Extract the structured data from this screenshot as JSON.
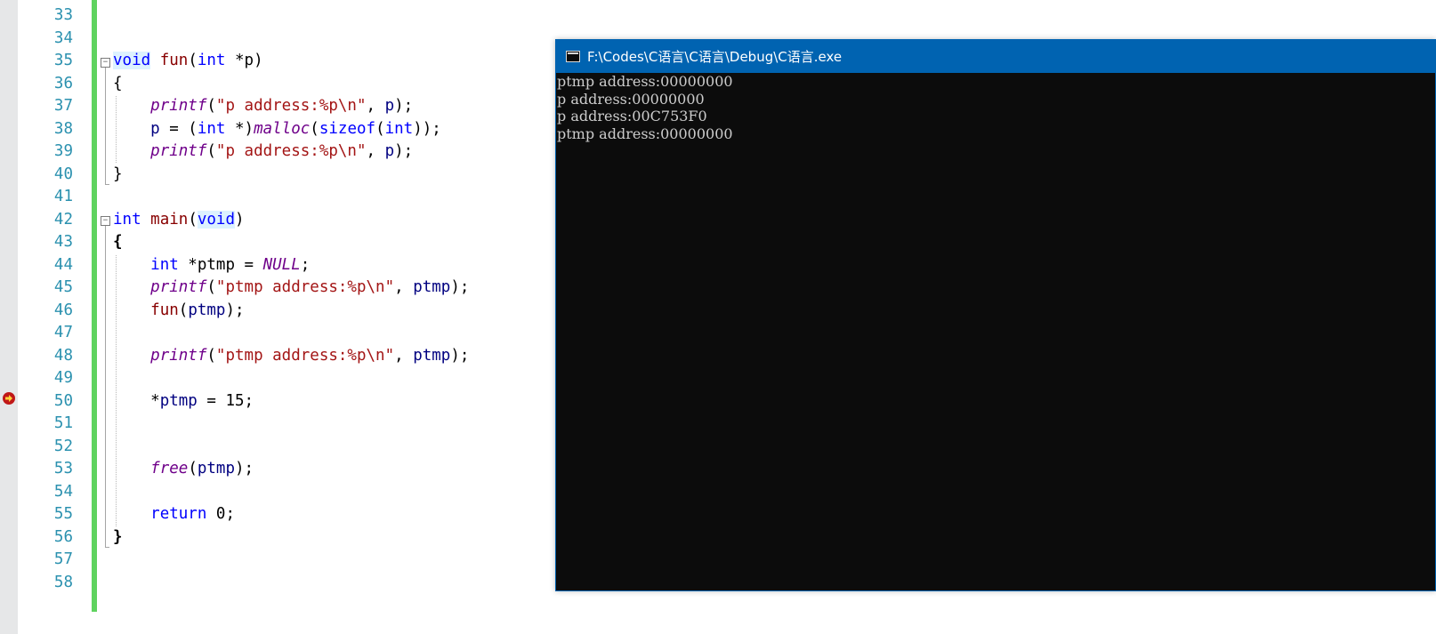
{
  "editor": {
    "line_numbers": [
      "33",
      "34",
      "35",
      "36",
      "37",
      "38",
      "39",
      "40",
      "41",
      "42",
      "43",
      "44",
      "45",
      "46",
      "47",
      "48",
      "49",
      "50",
      "51",
      "52",
      "53",
      "54",
      "55",
      "56",
      "57",
      "58"
    ],
    "breakpoint_line": "50",
    "code": {
      "l35": {
        "kw": "void",
        "fn": "fun",
        "p1": "(",
        "kw2": "int",
        "rest": " *p)"
      },
      "l36": "{",
      "l37": {
        "indent": "    ",
        "macro": "printf",
        "p1": "(",
        "str": "\"p address:%p\\n\"",
        "p2": ", ",
        "var": "p",
        "p3": ");"
      },
      "l38": {
        "indent": "    ",
        "var": "p",
        "p1": " = (",
        "kw": "int",
        "p2": " *)",
        "macro": "malloc",
        "p3": "(",
        "kw2": "sizeof",
        "p4": "(",
        "kw3": "int",
        "p5": "));"
      },
      "l39": {
        "indent": "    ",
        "macro": "printf",
        "p1": "(",
        "str": "\"p address:%p\\n\"",
        "p2": ", ",
        "var": "p",
        "p3": ");"
      },
      "l40": "}",
      "l42": {
        "kw": "int",
        "fn": "main",
        "p1": "(",
        "kw2": "void",
        "p2": ")"
      },
      "l43": "{",
      "l44": {
        "indent": "    ",
        "kw": "int",
        "p1": " *ptmp = ",
        "macro": "NULL",
        "p2": ";"
      },
      "l45": {
        "indent": "    ",
        "macro": "printf",
        "p1": "(",
        "str": "\"ptmp address:%p\\n\"",
        "p2": ", ",
        "var": "ptmp",
        "p3": ");"
      },
      "l46": {
        "indent": "    ",
        "fn": "fun",
        "p1": "(",
        "var": "ptmp",
        "p2": ");"
      },
      "l48": {
        "indent": "    ",
        "macro": "printf",
        "p1": "(",
        "str": "\"ptmp address:%p\\n\"",
        "p2": ", ",
        "var": "ptmp",
        "p3": ");"
      },
      "l50": {
        "indent": "    ",
        "p1": "*",
        "var": "ptmp",
        "p2": " = 15;"
      },
      "l53": {
        "indent": "    ",
        "macro": "free",
        "p1": "(",
        "var": "ptmp",
        "p2": ");"
      },
      "l55": {
        "indent": "    ",
        "kw": "return",
        "p1": " 0;"
      },
      "l56": "}"
    }
  },
  "console": {
    "title": "F:\\Codes\\C语言\\C语言\\Debug\\C语言.exe",
    "lines": [
      "ptmp address:00000000",
      "p address:00000000",
      "p address:00C753F0",
      "ptmp address:00000000"
    ]
  },
  "icons": {
    "breakpoint": "current-statement-arrow-icon",
    "fold": "collapse-minus-icon",
    "console": "console-window-icon"
  },
  "colors": {
    "keyword": "#0000ff",
    "function": "#880000",
    "macro": "#6f008a",
    "string": "#a31515",
    "variable": "#000080",
    "line_number": "#2b91af",
    "change_bar": "#5fd35f",
    "console_title_bg": "#0063b1",
    "console_bg": "#0c0c0c",
    "console_text": "#cccccc",
    "breakpoint": "#c01818"
  }
}
